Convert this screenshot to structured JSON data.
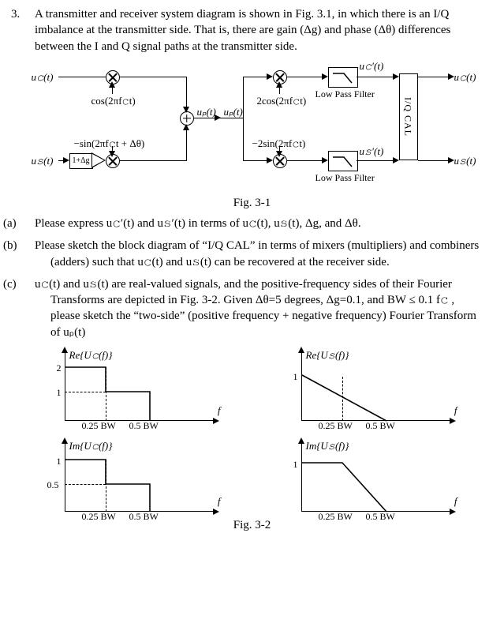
{
  "problem": {
    "number": "3.",
    "intro": "A transmitter and receiver system diagram is shown in Fig. 3.1, in which there is an I/Q imbalance at the transmitter side. That is, there are gain (Δg) and phase (Δθ) differences between the I and Q signal paths at the transmitter side.",
    "fig1_caption": "Fig. 3-1",
    "parts": {
      "a": {
        "label": "(a)",
        "text": "Please express u𝚌′(t) and u𝚜′(t) in terms of u𝚌(t), u𝚜(t), Δg, and Δθ."
      },
      "b": {
        "label": "(b)",
        "text": "Please sketch the block diagram of “I/Q CAL” in terms of mixers (multipliers) and combiners (adders) such that  u𝚌(t) and u𝚜(t) can be recovered at the receiver side."
      },
      "c": {
        "label": "(c)",
        "text": "u𝚌(t) and u𝚜(t) are real-valued signals, and the positive-frequency sides of their Fourier Transforms are depicted in Fig. 3-2. Given Δθ=5 degrees, Δg=0.1, and BW ≤ 0.1 f𝚌 , please sketch the “two-side” (positive frequency + negative frequency) Fourier Transform of uₚ(t)"
      }
    },
    "fig2_caption": "Fig. 3-2"
  },
  "fig1": {
    "uc_in": "u𝚌(t)",
    "us_in": "u𝚜(t)",
    "cos": "cos(2πf𝚌t)",
    "nsin": "−sin(2πf𝚌t + Δθ)",
    "gain": "1+Δg",
    "up": "uₚ(t)",
    "up2": "uₚ(t)",
    "twocos": "2cos(2πf𝚌t)",
    "ntwosin": "−2sin(2πf𝚌t)",
    "uc_prime": "u𝚌′(t)",
    "us_prime": "u𝚜′(t)",
    "lpf_top": "Low Pass Filter",
    "lpf_bot": "Low Pass Filter",
    "iqcal": "I/Q CAL",
    "uc_out": "u𝚌(t)",
    "us_out": "u𝚜(t)"
  },
  "plots": {
    "axis_f": "f",
    "t25": "0.25 BW",
    "t50": "0.5 BW",
    "reUc": {
      "title": "Re{U𝚌(f)}",
      "y2": "2",
      "y1": "1"
    },
    "reUs": {
      "title": "Re{U𝚜(f)}",
      "y1": "1"
    },
    "imUc": {
      "title": "Im{U𝚌(f)}",
      "y1": "1",
      "y05": "0.5"
    },
    "imUs": {
      "title": "Im{U𝚜(f)}",
      "y1": "1"
    }
  },
  "chart_data": [
    {
      "type": "line",
      "name": "Re{U_c(f)}",
      "x_units": "BW",
      "points": [
        [
          0,
          2
        ],
        [
          0.25,
          2
        ],
        [
          0.25,
          1
        ],
        [
          0.5,
          1
        ],
        [
          0.5,
          0
        ]
      ],
      "xlabel": "f",
      "xlim": [
        0,
        0.6
      ],
      "ylim": [
        0,
        2
      ]
    },
    {
      "type": "line",
      "name": "Re{U_s(f)}",
      "x_units": "BW",
      "points": [
        [
          0,
          1
        ],
        [
          0.5,
          0
        ]
      ],
      "xlabel": "f",
      "xlim": [
        0,
        0.6
      ],
      "ylim": [
        0,
        1
      ]
    },
    {
      "type": "line",
      "name": "Im{U_c(f)}",
      "x_units": "BW",
      "points": [
        [
          0,
          1
        ],
        [
          0.25,
          1
        ],
        [
          0.25,
          0.5
        ],
        [
          0.5,
          0.5
        ],
        [
          0.5,
          0
        ]
      ],
      "xlabel": "f",
      "xlim": [
        0,
        0.6
      ],
      "ylim": [
        0,
        1
      ]
    },
    {
      "type": "line",
      "name": "Im{U_s(f)}",
      "x_units": "BW",
      "points": [
        [
          0,
          1
        ],
        [
          0.25,
          1
        ],
        [
          0.5,
          0
        ]
      ],
      "xlabel": "f",
      "xlim": [
        0,
        0.6
      ],
      "ylim": [
        0,
        1
      ]
    }
  ]
}
